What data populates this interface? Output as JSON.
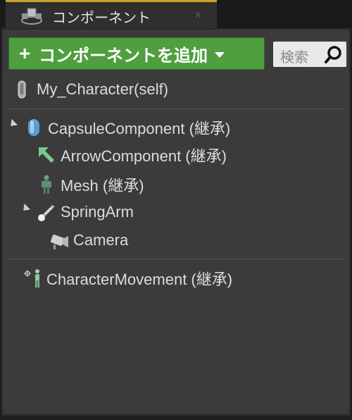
{
  "tab": {
    "title": "コンポーネント",
    "close": "×",
    "icon": "component-cubes-icon"
  },
  "toolbar": {
    "add_plus": "+",
    "add_label": "コンポーネントを追加",
    "add_color": "#4f9f3f",
    "search_placeholder": "検索"
  },
  "tree": {
    "root": {
      "label": "My_Character(self)",
      "icon": "character-capsule-icon"
    },
    "items": [
      {
        "label": "CapsuleComponent (継承)",
        "icon": "capsule-icon",
        "expanded": true
      },
      {
        "label": "ArrowComponent (継承)",
        "icon": "arrow-icon"
      },
      {
        "label": "Mesh (継承)",
        "icon": "skeletal-mesh-icon"
      },
      {
        "label": "SpringArm",
        "icon": "spring-arm-icon",
        "expanded": true
      },
      {
        "label": "Camera",
        "icon": "camera-icon"
      }
    ],
    "movement": {
      "label": "CharacterMovement (継承)",
      "icon": "character-movement-icon"
    }
  }
}
